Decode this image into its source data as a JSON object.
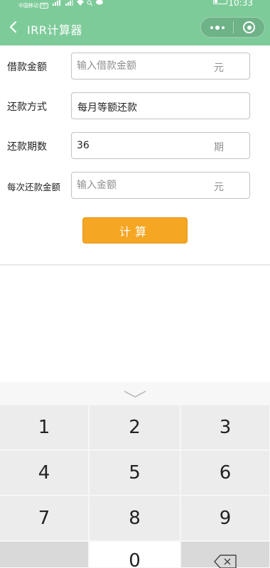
{
  "status_bar": {
    "carrier": "中国移动",
    "network_badge": "HD",
    "time": "10:33"
  },
  "header": {
    "title": "IRR计算器",
    "back_icon": "chevron-left-icon",
    "menu_icon": "more-dots-icon",
    "close_icon": "target-close-icon",
    "background": "#7ecb9a"
  },
  "form": {
    "loan_amount": {
      "label": "借款金额",
      "placeholder": "输入借款金额",
      "value": "",
      "unit": "元"
    },
    "repayment_method": {
      "label": "还款方式",
      "value": "每月等额还款"
    },
    "periods": {
      "label": "还款期数",
      "value": "36",
      "unit": "期"
    },
    "payment_amount": {
      "label": "每次还款金额",
      "placeholder": "输入金额",
      "value": "",
      "unit": "元"
    }
  },
  "calculate_button": {
    "label": "计算",
    "color": "#f5a623"
  },
  "keyboard": {
    "collapse_icon": "chevron-down-icon",
    "keys": [
      "1",
      "2",
      "3",
      "4",
      "5",
      "6",
      "7",
      "8",
      "9",
      "0"
    ],
    "delete_icon": "backspace-icon"
  }
}
